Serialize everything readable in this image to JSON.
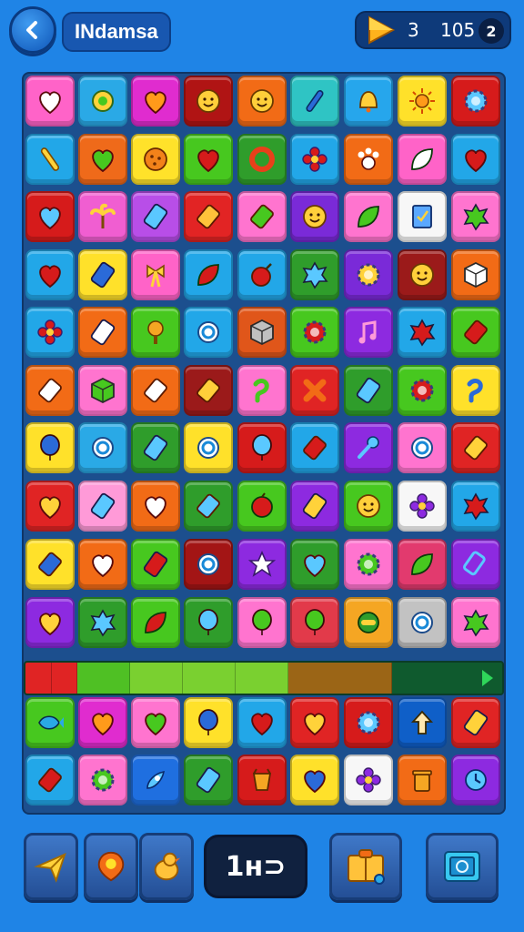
{
  "header": {
    "title": "INdamsa",
    "level": "3",
    "score": "105",
    "badge": "2"
  },
  "board": {
    "rows": [
      [
        "#ff63c8:heart-icon",
        "#2aa9e6:target-icon",
        "#e02ccf:heart-icon",
        "#b01414:smiley-icon",
        "#f26b16:smiley-icon",
        "#2fc4c4:wand-icon",
        "#26a6ec:bell-icon",
        "#ffe12a:sun-icon",
        "#d61b1b:gear-icon"
      ],
      [
        "#22a7e8:stick-icon",
        "#ef6a1a:heart-icon",
        "#ffe22a:cookie-icon",
        "#47c81f:heart-icon",
        "#2f9d2b:donut-icon",
        "#22a7e8:flower-icon",
        "#f26b16:paw-icon",
        "#ff63c8:leaf-icon",
        "#22a7e8:heart-icon"
      ],
      [
        "#d61b1b:heart-icon",
        "#f05ed1:palm-icon",
        "#b84ee8:gem-icon",
        "#e22424:candy-icon",
        "#ff74cf:candy-icon",
        "#7a2ad8:smiley-icon",
        "#ff74cf:leaf-icon",
        "#f7f7f7:card-icon",
        "#ff74cf:splat-icon"
      ],
      [
        "#22a7e8:heart-icon",
        "#ffe12a:gem-icon",
        "#ff63c8:ribbon-icon",
        "#22a7e8:leaf-icon",
        "#22a7e8:bomb-icon",
        "#2f9d2b:splat-icon",
        "#7a2ad8:gear-icon",
        "#9b1a1a:smiley-icon",
        "#f26b16:cube-icon"
      ],
      [
        "#22a7e8:flower-icon",
        "#f26b16:gem-icon",
        "#47c81f:tree-icon",
        "#22a7e8:ring-icon",
        "#e0561a:cube-icon",
        "#47c81f:gear-icon",
        "#8d2ae0:music-icon",
        "#22a7e8:splat-icon",
        "#47c81f:candy-icon"
      ],
      [
        "#f26b16:candy-icon",
        "#ff74cf:cube-icon",
        "#f26b16:candy-icon",
        "#9b1a1a:candy-icon",
        "#ff74cf:hook-icon",
        "#e02424:x-icon",
        "#2f9d2b:gem-icon",
        "#47c81f:gear-icon",
        "#ffe12a:hook-icon"
      ],
      [
        "#ffe12a:balloon-icon",
        "#2aa9e6:ring-icon",
        "#2f9d2b:gem-icon",
        "#ffe12a:ring-icon",
        "#d61b1b:balloon-icon",
        "#22a7e8:candy-icon",
        "#8d2ae0:key-icon",
        "#ff74cf:ring-icon",
        "#e02424:candy-icon"
      ],
      [
        "#e02424:heart-icon",
        "#ff9ad8:gem-icon",
        "#f26b16:heart-icon",
        "#2f9d2b:candy-icon",
        "#47c81f:apple-icon",
        "#8d2ae0:gem-icon",
        "#47c81f:smiley-icon",
        "#f7f7f7:flower-icon",
        "#22a7e8:splat-icon"
      ],
      [
        "#ffe12a:candy-icon",
        "#f26b16:heart-icon",
        "#47c81f:gem-icon",
        "#a31515:ring-icon",
        "#8d2ae0:star-icon",
        "#2f9d2b:heart-icon",
        "#ff74cf:gear-icon",
        "#e23a6e:leaf-icon",
        "#8d2ae0:tag-icon"
      ],
      [
        "#8d2ae0:heart-icon",
        "#2f9d2b:splat-icon",
        "#47c81f:leaf-icon",
        "#2f9d2b:balloon-icon",
        "#ff74cf:balloon-icon",
        "#e23a4a:balloon-icon",
        "#f5a623:eye-icon",
        "#c2c2c2:ring-icon",
        "#ff74cf:splat-icon"
      ],
      [
        "#47c81f:fish-icon",
        "#e02ccf:heart-icon",
        "#ff74cf:heart-icon",
        "#ffe12a:balloon-icon",
        "#22a7e8:heart-icon",
        "#e02424:heart-icon",
        "#d61b1b:gear-icon",
        "#0f5fc8:arrow-icon",
        "#e02424:gem-icon"
      ],
      [
        "#22a7e8:candy-icon",
        "#ff74cf:gear-icon",
        "#1f6fe0:rocket-icon",
        "#2f9d2b:gem-icon",
        "#d61b1b:bucket-icon",
        "#ffe12a:heart-icon",
        "#f7f7f7:flower-icon",
        "#f26b16:trash-icon",
        "#8d2ae0:clock-icon"
      ]
    ]
  },
  "progress": {
    "level": 0.9,
    "segments_colors": [
      "#e02424",
      "#e02424",
      "#4fc024",
      "#7ad030",
      "#7ad030",
      "#7ad030",
      "#9b6516",
      "#0f5a2e"
    ]
  },
  "footer": {
    "moves": "1н⊃"
  },
  "colors": {
    "background": "#1f84e6",
    "board": "#1c4f8e"
  }
}
